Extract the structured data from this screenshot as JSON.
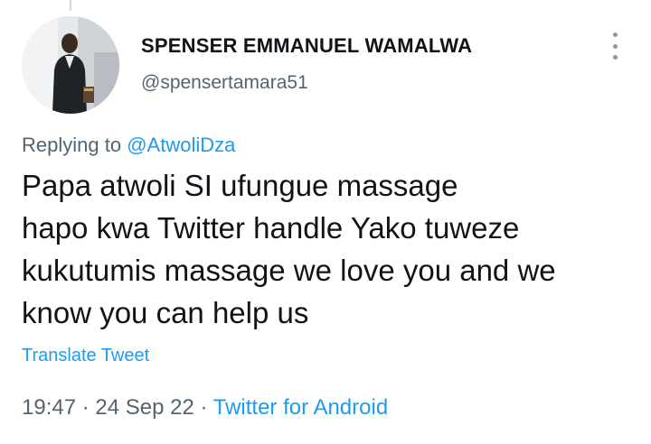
{
  "tweet": {
    "author": {
      "display_name": "SPENSER EMMANUEL WAMALWA",
      "handle": "@spensertamara51"
    },
    "replying_to": {
      "prefix": "Replying to",
      "mention": "@AtwoliDza"
    },
    "text_lines": [
      "Papa atwoli SI ufungue massage",
      "hapo kwa Twitter handle Yako tuweze",
      "kukutumis massage we love you and we",
      "know you can help us"
    ],
    "translate_label": "Translate Tweet",
    "meta": {
      "time": "19:47",
      "separator": "·",
      "date": "24 Sep 22",
      "source": "Twitter for Android"
    },
    "icons": {
      "more": "more-options-icon"
    }
  },
  "colors": {
    "text_primary": "#0f1419",
    "text_secondary": "#536471",
    "accent": "#1d9bf0"
  }
}
